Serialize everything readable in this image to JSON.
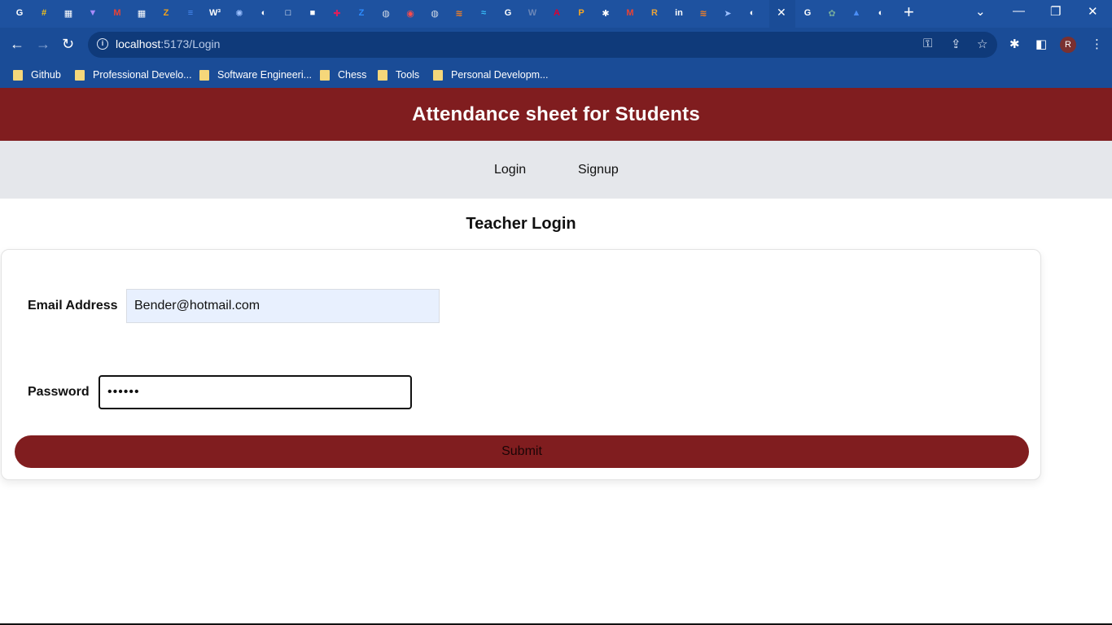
{
  "browser": {
    "tab_icons": [
      {
        "name": "google-tab-icon",
        "glyph": "G",
        "color": "#ffffff"
      },
      {
        "name": "hash-tab-icon",
        "glyph": "#",
        "color": "#f2c21b"
      },
      {
        "name": "trello-tab-icon",
        "glyph": "▦",
        "color": "#ffffff"
      },
      {
        "name": "vite-tab-icon",
        "glyph": "▼",
        "color": "#a78bfa"
      },
      {
        "name": "gmail-tab-icon",
        "glyph": "M",
        "color": "#ea4335"
      },
      {
        "name": "trello-tab-icon-2",
        "glyph": "▦",
        "color": "#ffffff"
      },
      {
        "name": "zoho-tab-icon",
        "glyph": "Z",
        "color": "#f3a21b"
      },
      {
        "name": "docs-tab-icon",
        "glyph": "≡",
        "color": "#4a8df6"
      },
      {
        "name": "w3schools-tab-icon",
        "glyph": "W³",
        "color": "#ffffff"
      },
      {
        "name": "spinner-tab-icon",
        "glyph": "✺",
        "color": "#9cc0ff"
      },
      {
        "name": "github-tab-icon",
        "glyph": "◐",
        "color": "#ffffff"
      },
      {
        "name": "square-tab-icon",
        "glyph": "□",
        "color": "#ffffff"
      },
      {
        "name": "notion-tab-icon",
        "glyph": "■",
        "color": "#ffffff"
      },
      {
        "name": "slack-tab-icon",
        "glyph": "✚",
        "color": "#e01e5a"
      },
      {
        "name": "zoom-tab-icon",
        "glyph": "Z",
        "color": "#2d8cff"
      },
      {
        "name": "globe-tab-icon",
        "glyph": "◍",
        "color": "#cfd8e6"
      },
      {
        "name": "record-tab-icon",
        "glyph": "◉",
        "color": "#ff4b4b"
      },
      {
        "name": "globe-tab-icon-2",
        "glyph": "◍",
        "color": "#cfd8e6"
      },
      {
        "name": "stackoverflow-tab-icon",
        "glyph": "≋",
        "color": "#f48024"
      },
      {
        "name": "tailwind-tab-icon",
        "glyph": "≈",
        "color": "#38bdf8"
      },
      {
        "name": "google-tab-icon-2",
        "glyph": "G",
        "color": "#ffffff"
      },
      {
        "name": "wordpress-tab-icon",
        "glyph": "W",
        "color": "#6b87b8"
      },
      {
        "name": "angular-tab-icon",
        "glyph": "A",
        "color": "#dd0031"
      },
      {
        "name": "postman-tab-icon",
        "glyph": "P",
        "color": "#f6a623"
      },
      {
        "name": "extension-tab-icon",
        "glyph": "✱",
        "color": "#ffffff"
      },
      {
        "name": "gmail-tab-icon-2",
        "glyph": "M",
        "color": "#ea4335"
      },
      {
        "name": "r-tab-icon",
        "glyph": "R",
        "color": "#e8a33b"
      },
      {
        "name": "linkedin-tab-icon",
        "glyph": "in",
        "color": "#ffffff"
      },
      {
        "name": "stackoverflow-tab-icon-2",
        "glyph": "≋",
        "color": "#f48024"
      },
      {
        "name": "send-tab-icon",
        "glyph": "➤",
        "color": "#9cc0ff"
      },
      {
        "name": "github-tab-icon-2",
        "glyph": "◐",
        "color": "#ffffff"
      }
    ],
    "tab_icons_after": [
      {
        "name": "google-tab-icon-3",
        "glyph": "G",
        "color": "#ffffff"
      },
      {
        "name": "chatgpt-tab-icon",
        "glyph": "✿",
        "color": "#74aa9c"
      },
      {
        "name": "school-tab-icon",
        "glyph": "▲",
        "color": "#4a8df6"
      },
      {
        "name": "github-tab-icon-3",
        "glyph": "◐",
        "color": "#ffffff"
      }
    ],
    "new_tab_glyph": "+",
    "close_tab_glyph": "✕",
    "url_host": "localhost",
    "url_path": ":5173/Login",
    "bookmarks": [
      "Github",
      "Professional Develo...",
      "Software Engineeri...",
      "Chess",
      "Tools",
      "Personal Developm..."
    ],
    "profile_initial": "R"
  },
  "page": {
    "header_title": "Attendance sheet for Students",
    "nav": {
      "login": "Login",
      "signup": "Signup"
    },
    "form_title": "Teacher Login",
    "email_label": "Email Address",
    "email_value": "Bender@hotmail.com",
    "password_label": "Password",
    "password_value": "••••••",
    "submit_label": "Submit"
  },
  "colors": {
    "header_bg": "#801d1f",
    "navbar_bg": "#e5e7eb",
    "chrome_bg": "#1a4c97",
    "email_autofill_bg": "#e8f0fe"
  }
}
